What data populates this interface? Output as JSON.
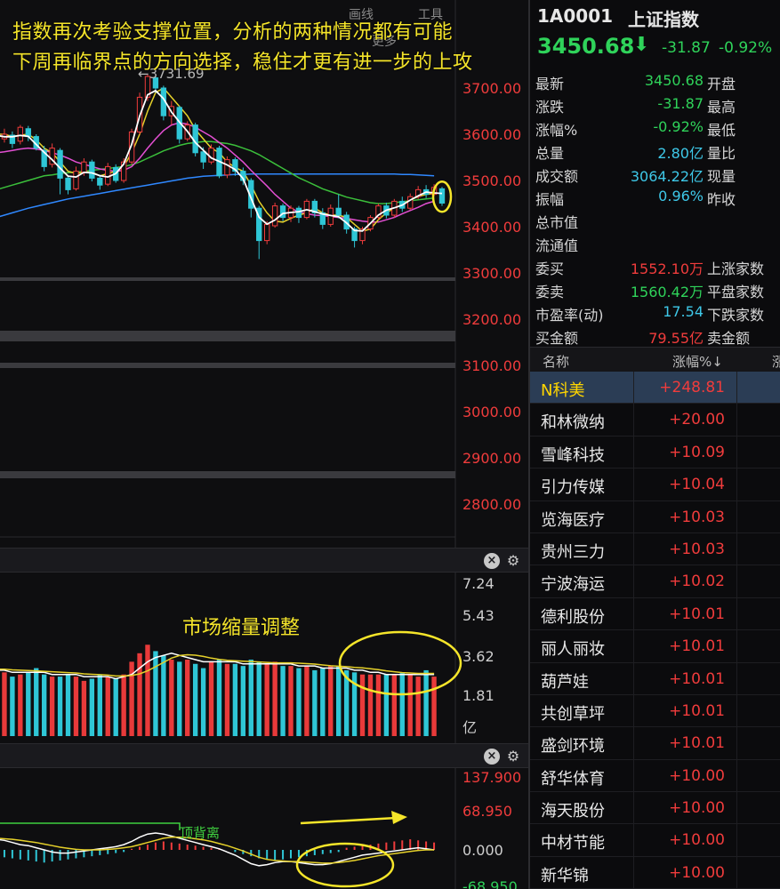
{
  "annotations": {
    "line1": "指数再次考验支撑位置，分析的两种情况都有可能",
    "line2": "下周再临界点的方向选择，稳住才更有进一步的上攻",
    "volume_note": "市场缩量调整",
    "divergence_label": "顶背离",
    "peak_label": "←3731.69"
  },
  "toolbar": {
    "draw_label": "画线",
    "tools_label": "工具",
    "more_label": "更多"
  },
  "price_axis": [
    "3700.00",
    "3600.00",
    "3500.00",
    "3400.00",
    "3300.00",
    "3200.00",
    "3100.00",
    "3000.00",
    "2900.00",
    "2800.00"
  ],
  "volume_axis": [
    "7.24",
    "5.43",
    "3.62",
    "1.81",
    "亿"
  ],
  "macd_axis": [
    "137.900",
    "68.950",
    "0.000",
    "-68.950"
  ],
  "quote": {
    "code": "1A0001",
    "name": "上证指数",
    "price": "3450.68",
    "change": "-31.87",
    "change_pct": "-0.92%",
    "stats": [
      {
        "label": "最新",
        "value": "3450.68",
        "value_color": "#2fd35a",
        "label2": "开盘"
      },
      {
        "label": "涨跌",
        "value": "-31.87",
        "value_color": "#2fd35a",
        "label2": "最高"
      },
      {
        "label": "涨幅%",
        "value": "-0.92%",
        "value_color": "#2fd35a",
        "label2": "最低"
      },
      {
        "label": "总量",
        "value": "2.80亿",
        "value_color": "#3ec8e8",
        "label2": "量比"
      },
      {
        "label": "成交额",
        "value": "3064.22亿",
        "value_color": "#3ec8e8",
        "label2": "现量"
      },
      {
        "label": "振幅",
        "value": "0.96%",
        "value_color": "#3ec8e8",
        "label2": "昨收"
      },
      {
        "label": "总市值",
        "value": "",
        "value_color": "#d6d6d6",
        "label2": ""
      },
      {
        "label": "流通值",
        "value": "",
        "value_color": "#d6d6d6",
        "label2": ""
      },
      {
        "label": "委买",
        "value": "1552.10万",
        "value_color": "#f03c3c",
        "label2": "上涨家数"
      },
      {
        "label": "委卖",
        "value": "1560.42万",
        "value_color": "#2fd35a",
        "label2": "平盘家数"
      },
      {
        "label": "市盈率(动)",
        "value": "17.54",
        "value_color": "#3ec8e8",
        "label2": "下跌家数"
      },
      {
        "label": "买金额",
        "value": "79.55亿",
        "value_color": "#f03c3c",
        "label2": "卖金额"
      }
    ]
  },
  "ranking": {
    "col_name": "名称",
    "col_pct": "涨幅%↓",
    "col_extra": "涨",
    "rows": [
      {
        "name": "N科美",
        "pct": "+248.81"
      },
      {
        "name": "和林微纳",
        "pct": "+20.00"
      },
      {
        "name": "雪峰科技",
        "pct": "+10.09"
      },
      {
        "name": "引力传媒",
        "pct": "+10.04"
      },
      {
        "name": "览海医疗",
        "pct": "+10.03"
      },
      {
        "name": "贵州三力",
        "pct": "+10.03"
      },
      {
        "name": "宁波海运",
        "pct": "+10.02"
      },
      {
        "name": "德利股份",
        "pct": "+10.01"
      },
      {
        "name": "丽人丽妆",
        "pct": "+10.01"
      },
      {
        "name": "葫芦娃",
        "pct": "+10.01"
      },
      {
        "name": "共创草坪",
        "pct": "+10.01"
      },
      {
        "name": "盛剑环境",
        "pct": "+10.01"
      },
      {
        "name": "舒华体育",
        "pct": "+10.00"
      },
      {
        "name": "海天股份",
        "pct": "+10.00"
      },
      {
        "name": "中材节能",
        "pct": "+10.00"
      },
      {
        "name": "新华锦",
        "pct": "+10.00"
      }
    ]
  },
  "chart_data": {
    "type": "candlestick",
    "price_ylim": [
      2800,
      3700
    ],
    "candles": [
      {
        "o": 3610,
        "c": 3590,
        "h": 3625,
        "l": 3580
      },
      {
        "o": 3590,
        "c": 3600,
        "h": 3612,
        "l": 3582
      },
      {
        "o": 3598,
        "c": 3580,
        "h": 3606,
        "l": 3570
      },
      {
        "o": 3585,
        "c": 3615,
        "h": 3620,
        "l": 3578
      },
      {
        "o": 3612,
        "c": 3595,
        "h": 3618,
        "l": 3585
      },
      {
        "o": 3595,
        "c": 3570,
        "h": 3600,
        "l": 3565
      },
      {
        "o": 3565,
        "c": 3530,
        "h": 3575,
        "l": 3520
      },
      {
        "o": 3535,
        "c": 3570,
        "h": 3580,
        "l": 3528
      },
      {
        "o": 3565,
        "c": 3505,
        "h": 3570,
        "l": 3470
      },
      {
        "o": 3505,
        "c": 3480,
        "h": 3512,
        "l": 3470
      },
      {
        "o": 3482,
        "c": 3520,
        "h": 3530,
        "l": 3478
      },
      {
        "o": 3518,
        "c": 3540,
        "h": 3548,
        "l": 3510
      },
      {
        "o": 3540,
        "c": 3505,
        "h": 3545,
        "l": 3498
      },
      {
        "o": 3505,
        "c": 3490,
        "h": 3512,
        "l": 3480
      },
      {
        "o": 3492,
        "c": 3530,
        "h": 3538,
        "l": 3488
      },
      {
        "o": 3528,
        "c": 3500,
        "h": 3535,
        "l": 3495
      },
      {
        "o": 3500,
        "c": 3540,
        "h": 3548,
        "l": 3495
      },
      {
        "o": 3540,
        "c": 3605,
        "h": 3612,
        "l": 3535
      },
      {
        "o": 3605,
        "c": 3680,
        "h": 3690,
        "l": 3600
      },
      {
        "o": 3680,
        "c": 3725,
        "h": 3731,
        "l": 3672
      },
      {
        "o": 3722,
        "c": 3700,
        "h": 3728,
        "l": 3690
      },
      {
        "o": 3700,
        "c": 3640,
        "h": 3705,
        "l": 3630
      },
      {
        "o": 3640,
        "c": 3660,
        "h": 3672,
        "l": 3620
      },
      {
        "o": 3658,
        "c": 3590,
        "h": 3662,
        "l": 3580
      },
      {
        "o": 3590,
        "c": 3620,
        "h": 3628,
        "l": 3585
      },
      {
        "o": 3620,
        "c": 3560,
        "h": 3625,
        "l": 3552
      },
      {
        "o": 3562,
        "c": 3540,
        "h": 3572,
        "l": 3525
      },
      {
        "o": 3540,
        "c": 3570,
        "h": 3578,
        "l": 3535
      },
      {
        "o": 3570,
        "c": 3510,
        "h": 3575,
        "l": 3505
      },
      {
        "o": 3512,
        "c": 3545,
        "h": 3552,
        "l": 3505
      },
      {
        "o": 3545,
        "c": 3520,
        "h": 3550,
        "l": 3510
      },
      {
        "o": 3520,
        "c": 3500,
        "h": 3528,
        "l": 3490
      },
      {
        "o": 3500,
        "c": 3440,
        "h": 3505,
        "l": 3420
      },
      {
        "o": 3440,
        "c": 3370,
        "h": 3445,
        "l": 3330
      },
      {
        "o": 3370,
        "c": 3405,
        "h": 3412,
        "l": 3362
      },
      {
        "o": 3402,
        "c": 3445,
        "h": 3452,
        "l": 3398
      },
      {
        "o": 3445,
        "c": 3420,
        "h": 3450,
        "l": 3412
      },
      {
        "o": 3420,
        "c": 3440,
        "h": 3446,
        "l": 3410
      },
      {
        "o": 3440,
        "c": 3420,
        "h": 3445,
        "l": 3408
      },
      {
        "o": 3420,
        "c": 3455,
        "h": 3460,
        "l": 3416
      },
      {
        "o": 3455,
        "c": 3430,
        "h": 3460,
        "l": 3420
      },
      {
        "o": 3430,
        "c": 3405,
        "h": 3440,
        "l": 3395
      },
      {
        "o": 3405,
        "c": 3440,
        "h": 3448,
        "l": 3400
      },
      {
        "o": 3440,
        "c": 3425,
        "h": 3470,
        "l": 3418
      },
      {
        "o": 3425,
        "c": 3395,
        "h": 3432,
        "l": 3385
      },
      {
        "o": 3395,
        "c": 3370,
        "h": 3400,
        "l": 3355
      },
      {
        "o": 3370,
        "c": 3395,
        "h": 3400,
        "l": 3362
      },
      {
        "o": 3395,
        "c": 3420,
        "h": 3425,
        "l": 3390
      },
      {
        "o": 3420,
        "c": 3445,
        "h": 3450,
        "l": 3415
      },
      {
        "o": 3445,
        "c": 3425,
        "h": 3452,
        "l": 3418
      },
      {
        "o": 3425,
        "c": 3455,
        "h": 3460,
        "l": 3420
      },
      {
        "o": 3455,
        "c": 3440,
        "h": 3465,
        "l": 3432
      },
      {
        "o": 3440,
        "c": 3465,
        "h": 3472,
        "l": 3436
      },
      {
        "o": 3465,
        "c": 3480,
        "h": 3488,
        "l": 3460
      },
      {
        "o": 3480,
        "c": 3470,
        "h": 3490,
        "l": 3462
      },
      {
        "o": 3470,
        "c": 3485,
        "h": 3492,
        "l": 3466
      },
      {
        "o": 3482,
        "c": 3451,
        "h": 3486,
        "l": 3445
      }
    ],
    "ma5": [
      3600,
      3600,
      3595,
      3598,
      3600,
      3588,
      3570,
      3560,
      3540,
      3520,
      3515,
      3518,
      3518,
      3510,
      3515,
      3520,
      3530,
      3560,
      3600,
      3650,
      3690,
      3700,
      3680,
      3660,
      3640,
      3610,
      3590,
      3570,
      3560,
      3540,
      3528,
      3520,
      3490,
      3455,
      3430,
      3412,
      3410,
      3418,
      3425,
      3430,
      3440,
      3430,
      3425,
      3425,
      3420,
      3405,
      3390,
      3395,
      3415,
      3430,
      3440,
      3448,
      3458,
      3465,
      3470,
      3472
    ],
    "ma10": [
      3560,
      3562,
      3565,
      3568,
      3570,
      3568,
      3565,
      3560,
      3555,
      3548,
      3540,
      3535,
      3530,
      3525,
      3522,
      3520,
      3522,
      3530,
      3548,
      3570,
      3590,
      3608,
      3620,
      3625,
      3622,
      3615,
      3605,
      3595,
      3582,
      3570,
      3555,
      3540,
      3522,
      3505,
      3488,
      3470,
      3455,
      3440,
      3432,
      3428,
      3425,
      3424,
      3422,
      3420,
      3418,
      3415,
      3412,
      3410,
      3410,
      3415,
      3420,
      3428,
      3435,
      3442,
      3450,
      3455
    ],
    "ma20": [
      3480,
      3485,
      3490,
      3495,
      3500,
      3505,
      3510,
      3512,
      3515,
      3517,
      3518,
      3520,
      3522,
      3524,
      3526,
      3528,
      3530,
      3534,
      3540,
      3548,
      3556,
      3564,
      3570,
      3576,
      3580,
      3582,
      3584,
      3584,
      3582,
      3580,
      3576,
      3570,
      3564,
      3556,
      3546,
      3536,
      3526,
      3516,
      3506,
      3498,
      3490,
      3482,
      3476,
      3470,
      3464,
      3460,
      3456,
      3452,
      3450,
      3450,
      3452,
      3454,
      3456,
      3458,
      3460,
      3462
    ],
    "ma60": [
      3420,
      3425,
      3430,
      3435,
      3440,
      3444,
      3448,
      3452,
      3456,
      3460,
      3463,
      3466,
      3469,
      3472,
      3475,
      3478,
      3481,
      3484,
      3487,
      3490,
      3493,
      3496,
      3499,
      3502,
      3505,
      3507,
      3509,
      3510,
      3511,
      3512,
      3513,
      3513,
      3514,
      3514,
      3514,
      3514,
      3514,
      3514,
      3514,
      3514,
      3514,
      3514,
      3514,
      3514,
      3514,
      3514,
      3514,
      3514,
      3514,
      3514,
      3514,
      3513,
      3513,
      3512,
      3511,
      3510
    ],
    "volume_ylim": [
      0,
      7.24
    ],
    "volumes": [
      3.1,
      3.0,
      2.8,
      2.9,
      3.0,
      3.2,
      2.9,
      2.8,
      2.8,
      2.9,
      2.8,
      2.6,
      2.7,
      2.9,
      2.8,
      2.7,
      2.9,
      3.5,
      3.9,
      4.3,
      4.0,
      3.8,
      3.6,
      3.5,
      3.6,
      3.4,
      3.2,
      3.5,
      3.6,
      3.4,
      3.4,
      3.3,
      3.6,
      3.5,
      3.4,
      3.5,
      3.3,
      3.3,
      3.2,
      3.3,
      3.1,
      3.2,
      3.3,
      3.3,
      3.1,
      3.0,
      2.9,
      2.9,
      2.9,
      2.9,
      2.9,
      3.0,
      2.9,
      2.8,
      3.1,
      2.8
    ],
    "vol_ma5": [
      3.1,
      3.1,
      3.0,
      3.0,
      3.0,
      3.0,
      3.0,
      2.9,
      2.9,
      2.9,
      2.9,
      2.8,
      2.8,
      2.8,
      2.8,
      2.7,
      2.8,
      2.9,
      3.2,
      3.5,
      3.7,
      3.8,
      3.9,
      3.8,
      3.7,
      3.6,
      3.5,
      3.5,
      3.5,
      3.5,
      3.5,
      3.4,
      3.4,
      3.4,
      3.4,
      3.4,
      3.4,
      3.4,
      3.3,
      3.3,
      3.3,
      3.2,
      3.2,
      3.2,
      3.2,
      3.1,
      3.1,
      3.0,
      3.0,
      2.9,
      2.9,
      2.9,
      2.9,
      2.9,
      2.9,
      2.9
    ],
    "macd_ylim": [
      -68.95,
      137.9
    ],
    "macd_hist": [
      -10,
      -14,
      -16,
      -18,
      -20,
      -22,
      -24,
      -22,
      -20,
      -18,
      -16,
      -14,
      -12,
      -10,
      -8,
      -6,
      -4,
      2,
      6,
      10,
      14,
      16,
      14,
      12,
      10,
      8,
      6,
      4,
      2,
      0,
      -4,
      -8,
      -12,
      -16,
      -18,
      -20,
      -18,
      -16,
      -14,
      -12,
      -10,
      -8,
      -6,
      -4,
      4,
      6,
      8,
      10,
      12,
      14,
      16,
      18,
      20,
      18,
      16,
      14
    ],
    "dif": [
      20,
      18,
      14,
      10,
      8,
      4,
      0,
      -4,
      -6,
      -6,
      -4,
      -2,
      0,
      2,
      4,
      6,
      10,
      16,
      24,
      30,
      32,
      30,
      26,
      22,
      18,
      14,
      10,
      6,
      2,
      -4,
      -10,
      -18,
      -26,
      -30,
      -28,
      -24,
      -22,
      -22,
      -24,
      -26,
      -28,
      -28,
      -26,
      -22,
      -18,
      -14,
      -10,
      -8,
      -6,
      -4,
      -2,
      0,
      2,
      4,
      2,
      0
    ],
    "dea": [
      22,
      21,
      20,
      18,
      16,
      14,
      11,
      8,
      5,
      3,
      1,
      0,
      0,
      0,
      1,
      2,
      4,
      6,
      10,
      14,
      18,
      22,
      24,
      24,
      23,
      21,
      19,
      16,
      12,
      8,
      3,
      -2,
      -8,
      -14,
      -18,
      -20,
      -21,
      -22,
      -22,
      -23,
      -24,
      -25,
      -25,
      -24,
      -22,
      -20,
      -17,
      -14,
      -11,
      -9,
      -7,
      -5,
      -3,
      -1,
      0,
      0
    ]
  }
}
